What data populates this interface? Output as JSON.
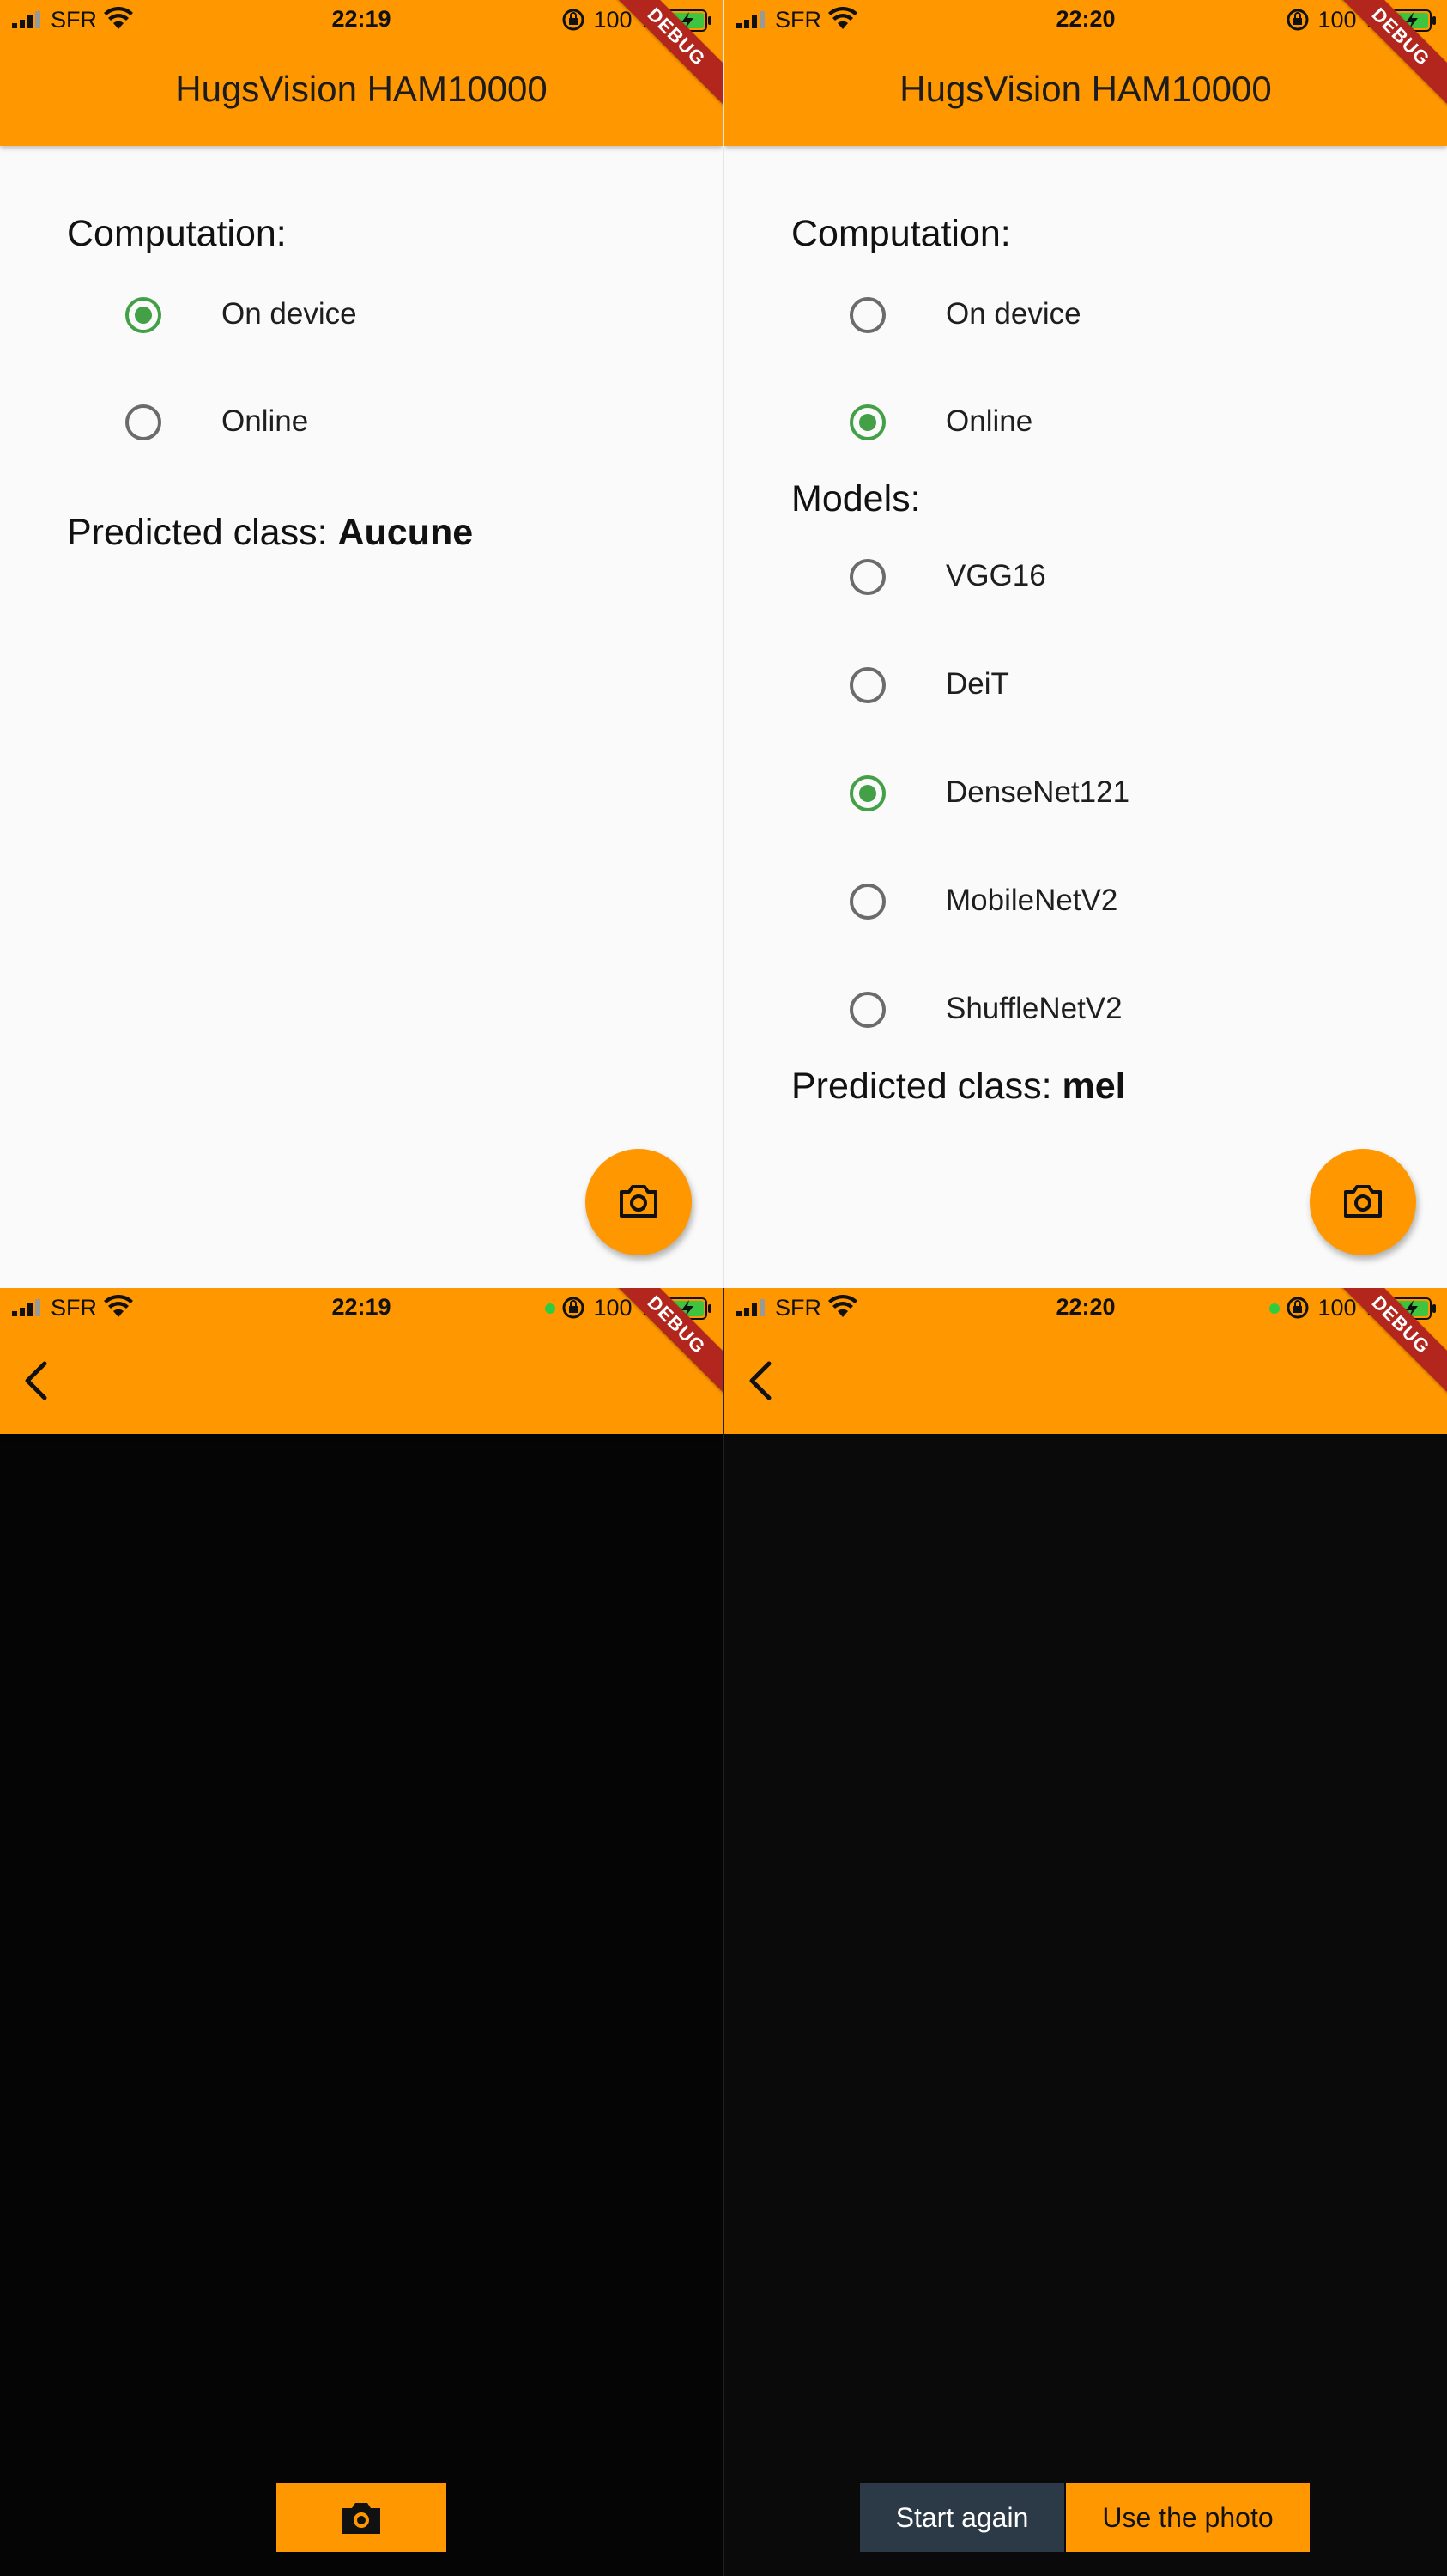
{
  "colors": {
    "accent": "#ff9800",
    "radio_selected": "#43a047",
    "debug_banner": "#b3261e",
    "camera_bg": "#050505",
    "start_again_bg": "#2c3a47"
  },
  "status": {
    "carrier": "SFR",
    "battery": "100 %",
    "time_screen1": "22:19",
    "time_screen2": "22:20",
    "time_screen3": "22:19",
    "time_screen4": "22:20"
  },
  "debug_label": "DEBUG",
  "app": {
    "title": "HugsVision HAM10000"
  },
  "screen1": {
    "computation_label": "Computation:",
    "computation_options": [
      {
        "label": "On device",
        "selected": true
      },
      {
        "label": "Online",
        "selected": false
      }
    ],
    "predicted_label": "Predicted class:",
    "predicted_value": "Aucune"
  },
  "screen2": {
    "computation_label": "Computation:",
    "computation_options": [
      {
        "label": "On device",
        "selected": false
      },
      {
        "label": "Online",
        "selected": true
      }
    ],
    "models_label": "Models:",
    "models": [
      {
        "label": "VGG16",
        "selected": false
      },
      {
        "label": "DeiT",
        "selected": false
      },
      {
        "label": "DenseNet121",
        "selected": true
      },
      {
        "label": "MobileNetV2",
        "selected": false
      },
      {
        "label": "ShuffleNetV2",
        "selected": false
      }
    ],
    "predicted_label": "Predicted class:",
    "predicted_value": "mel"
  },
  "screen4": {
    "start_again": "Start again",
    "use_photo": "Use the photo"
  },
  "icons": [
    "signal-icon",
    "wifi-icon",
    "orientation-lock-icon",
    "battery-charging-icon",
    "camera-icon",
    "back-arrow-icon"
  ]
}
